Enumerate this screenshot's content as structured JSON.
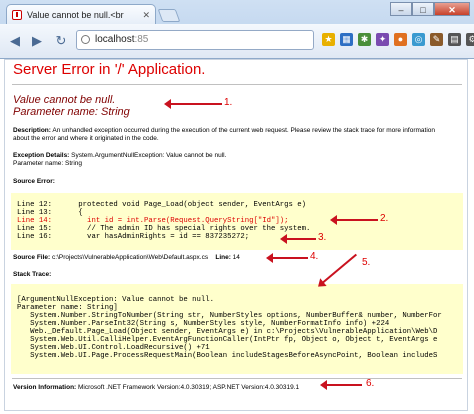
{
  "browser": {
    "tab_title": "Value cannot be null.<br",
    "address_host": "localhost",
    "address_port": ":85",
    "win_min": "–",
    "win_max": "□",
    "win_close": "✕"
  },
  "page": {
    "title": "Server Error in '/' Application.",
    "error_line1": "Value cannot be null.",
    "error_line2": "Parameter name: String",
    "description_label": "Description:",
    "description_text": " An unhandled exception occurred during the execution of the current web request. Please review the stack trace for more information about the error and where it originated in the code.",
    "exception_label": "Exception Details:",
    "exception_text": " System.ArgumentNullException: Value cannot be null.",
    "exception_param": "Parameter name: String",
    "source_error_label": "Source Error:",
    "source_lines": [
      {
        "text": "Line 12:      protected void Page_Load(object sender, EventArgs e)",
        "highlight": false
      },
      {
        "text": "Line 13:      {",
        "highlight": false
      },
      {
        "text": "Line 14:        int id = int.Parse(Request.QueryString[\"Id\"]);",
        "highlight": true
      },
      {
        "text": "Line 15:        // The admin ID has special rights over the system.",
        "highlight": false
      },
      {
        "text": "Line 16:        var hasAdminRights = id == 837235272;",
        "highlight": false
      }
    ],
    "source_file_label": "Source File:",
    "source_file_path": " c:\\Projects\\VulnerableApplication\\Web\\Default.aspx.cs",
    "line_label": "Line:",
    "line_number": " 14",
    "stack_trace_label": "Stack Trace:",
    "stack_lines": [
      "[ArgumentNullException: Value cannot be null.",
      "Parameter name: String]",
      "   System.Number.StringToNumber(String str, NumberStyles options, NumberBuffer& number, NumberFor",
      "   System.Number.ParseInt32(String s, NumberStyles style, NumberFormatInfo info) +224",
      "   Web._Default.Page_Load(Object sender, EventArgs e) in c:\\Projects\\VulnerableApplication\\Web\\D",
      "   System.Web.Util.CalliHelper.EventArgFunctionCaller(IntPtr fp, Object o, Object t, EventArgs e",
      "   System.Web.UI.Control.LoadRecursive() +71",
      "   System.Web.UI.Page.ProcessRequestMain(Boolean includeStagesBeforeAsyncPoint, Boolean includeS"
    ],
    "version_label": "Version Information:",
    "version_text": " Microsoft .NET Framework Version:4.0.30319; ASP.NET Version:4.0.30319.1"
  },
  "annotations": [
    "1.",
    "2.",
    "3.",
    "4.",
    "5.",
    "6."
  ],
  "colors": {
    "annotation": "#c9121f",
    "title": "#dd0000",
    "code_background": "#ffffcc"
  }
}
